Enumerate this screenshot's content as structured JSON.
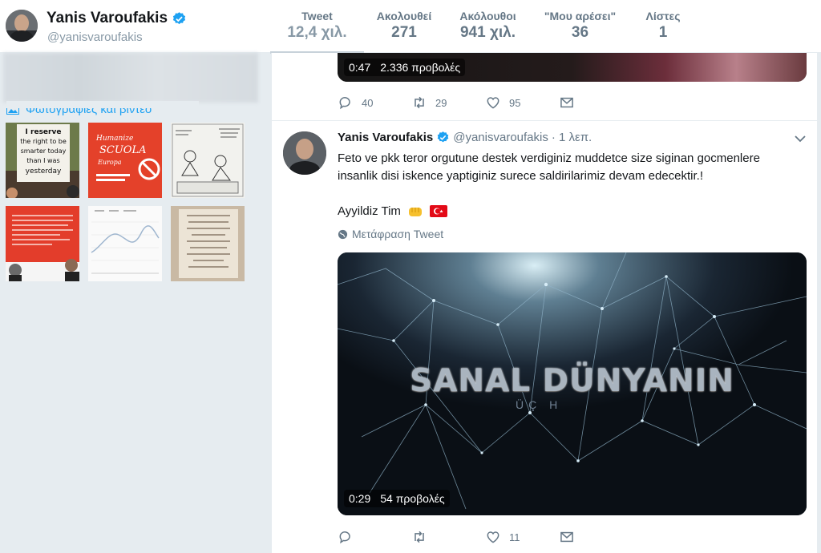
{
  "profile": {
    "name": "Yanis Varoufakis",
    "handle": "@yanisvaroufakis"
  },
  "stats": [
    {
      "label": "Tweet",
      "value": "12,4 χιλ."
    },
    {
      "label": "Ακολουθεί",
      "value": "271"
    },
    {
      "label": "Ακόλουθοι",
      "value": "941 χιλ."
    },
    {
      "label": "\"Μου αρέσει\"",
      "value": "36"
    },
    {
      "label": "Λίστες",
      "value": "1"
    }
  ],
  "sidebar": {
    "media_title": "Φωτογραφίες και βίντεο",
    "thumb_texts": {
      "sign": "I reserve the right to be smarter today than I was yesterday",
      "poster": "Humanize SCUOLA Europa"
    }
  },
  "prev_tweet": {
    "video_time": "0:47",
    "video_views": "2.336 προβολές",
    "replies": "40",
    "retweets": "29",
    "likes": "95"
  },
  "tweet": {
    "name": "Yanis Varoufakis",
    "handle": "@yanisvaroufakis",
    "time": "· 1 λεπ.",
    "text": "Feto ve pkk teror orgutune destek verdiginiz muddetce size siginan gocmenlere insanlik disi iskence yaptiginiz surece saldirilarimiz devam edecektir.!",
    "signature": "Ayyildiz Tim",
    "translate_label": "Μετάφραση Tweet",
    "video_title": "SANAL DÜNYANIN",
    "video_subtitle": "ÜÇ H",
    "video_time": "0:29",
    "video_views": "54 προβολές",
    "replies": "",
    "retweets": "",
    "likes": "11"
  },
  "colors": {
    "brand_blue": "#1da1f2",
    "muted_text": "#657786",
    "page_bg": "#e6ecf0",
    "flag_red": "#e30a17"
  }
}
